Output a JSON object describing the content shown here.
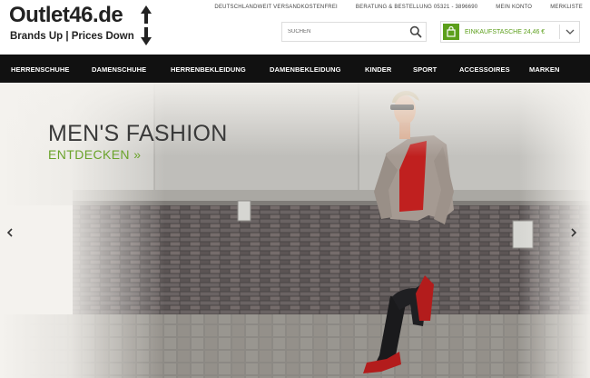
{
  "logo": {
    "wordmark": "Outlet46.de",
    "tagline": "Brands Up | Prices Down"
  },
  "top_links": [
    "Deutschlandweit Versandkostenfrei",
    "Beratung & Bestellung 05321 - 3896690",
    "Mein Konto",
    "Merkliste"
  ],
  "search": {
    "placeholder": "SUCHEN"
  },
  "cart": {
    "label": "Einkaufstasche 24,46 €"
  },
  "nav": {
    "items": [
      "HERRENSCHUHE",
      "DAMENSCHUHE",
      "HERRENBEKLEIDUNG",
      "DAMENBEKLEIDUNG",
      "KINDER",
      "SPORT",
      "ACCESSOIRES",
      "MARKEN"
    ]
  },
  "hero": {
    "title": "MEN'S FASHION",
    "cta": "ENTDECKEN »"
  },
  "colors": {
    "accent_green": "#5c9f1b",
    "nav_bg": "#111111"
  },
  "icons": [
    "search-icon",
    "shopping-bag-icon",
    "chevron-down-icon",
    "chevron-left-icon",
    "chevron-right-icon",
    "logo-arrows-icon"
  ]
}
